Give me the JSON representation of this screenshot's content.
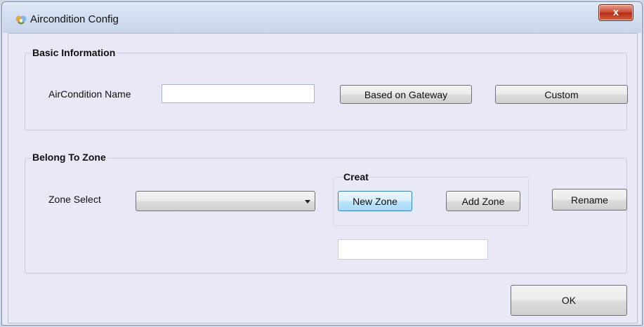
{
  "window": {
    "title": "Aircondition Config",
    "close_glyph": "x",
    "icon": "aircondition-app-icon"
  },
  "basic_info": {
    "legend": "Basic Information",
    "name_label": "AirCondition Name",
    "name_value": "",
    "based_on_gateway_label": "Based on Gateway",
    "custom_label": "Custom"
  },
  "zone": {
    "legend": "Belong To Zone",
    "zone_select_label": "Zone Select",
    "zone_select_value": "",
    "creat_legend": "Creat",
    "new_zone_label": "New Zone",
    "add_zone_label": "Add Zone",
    "rename_label": "Rename",
    "zone_name_value": ""
  },
  "footer": {
    "ok_label": "OK"
  }
}
